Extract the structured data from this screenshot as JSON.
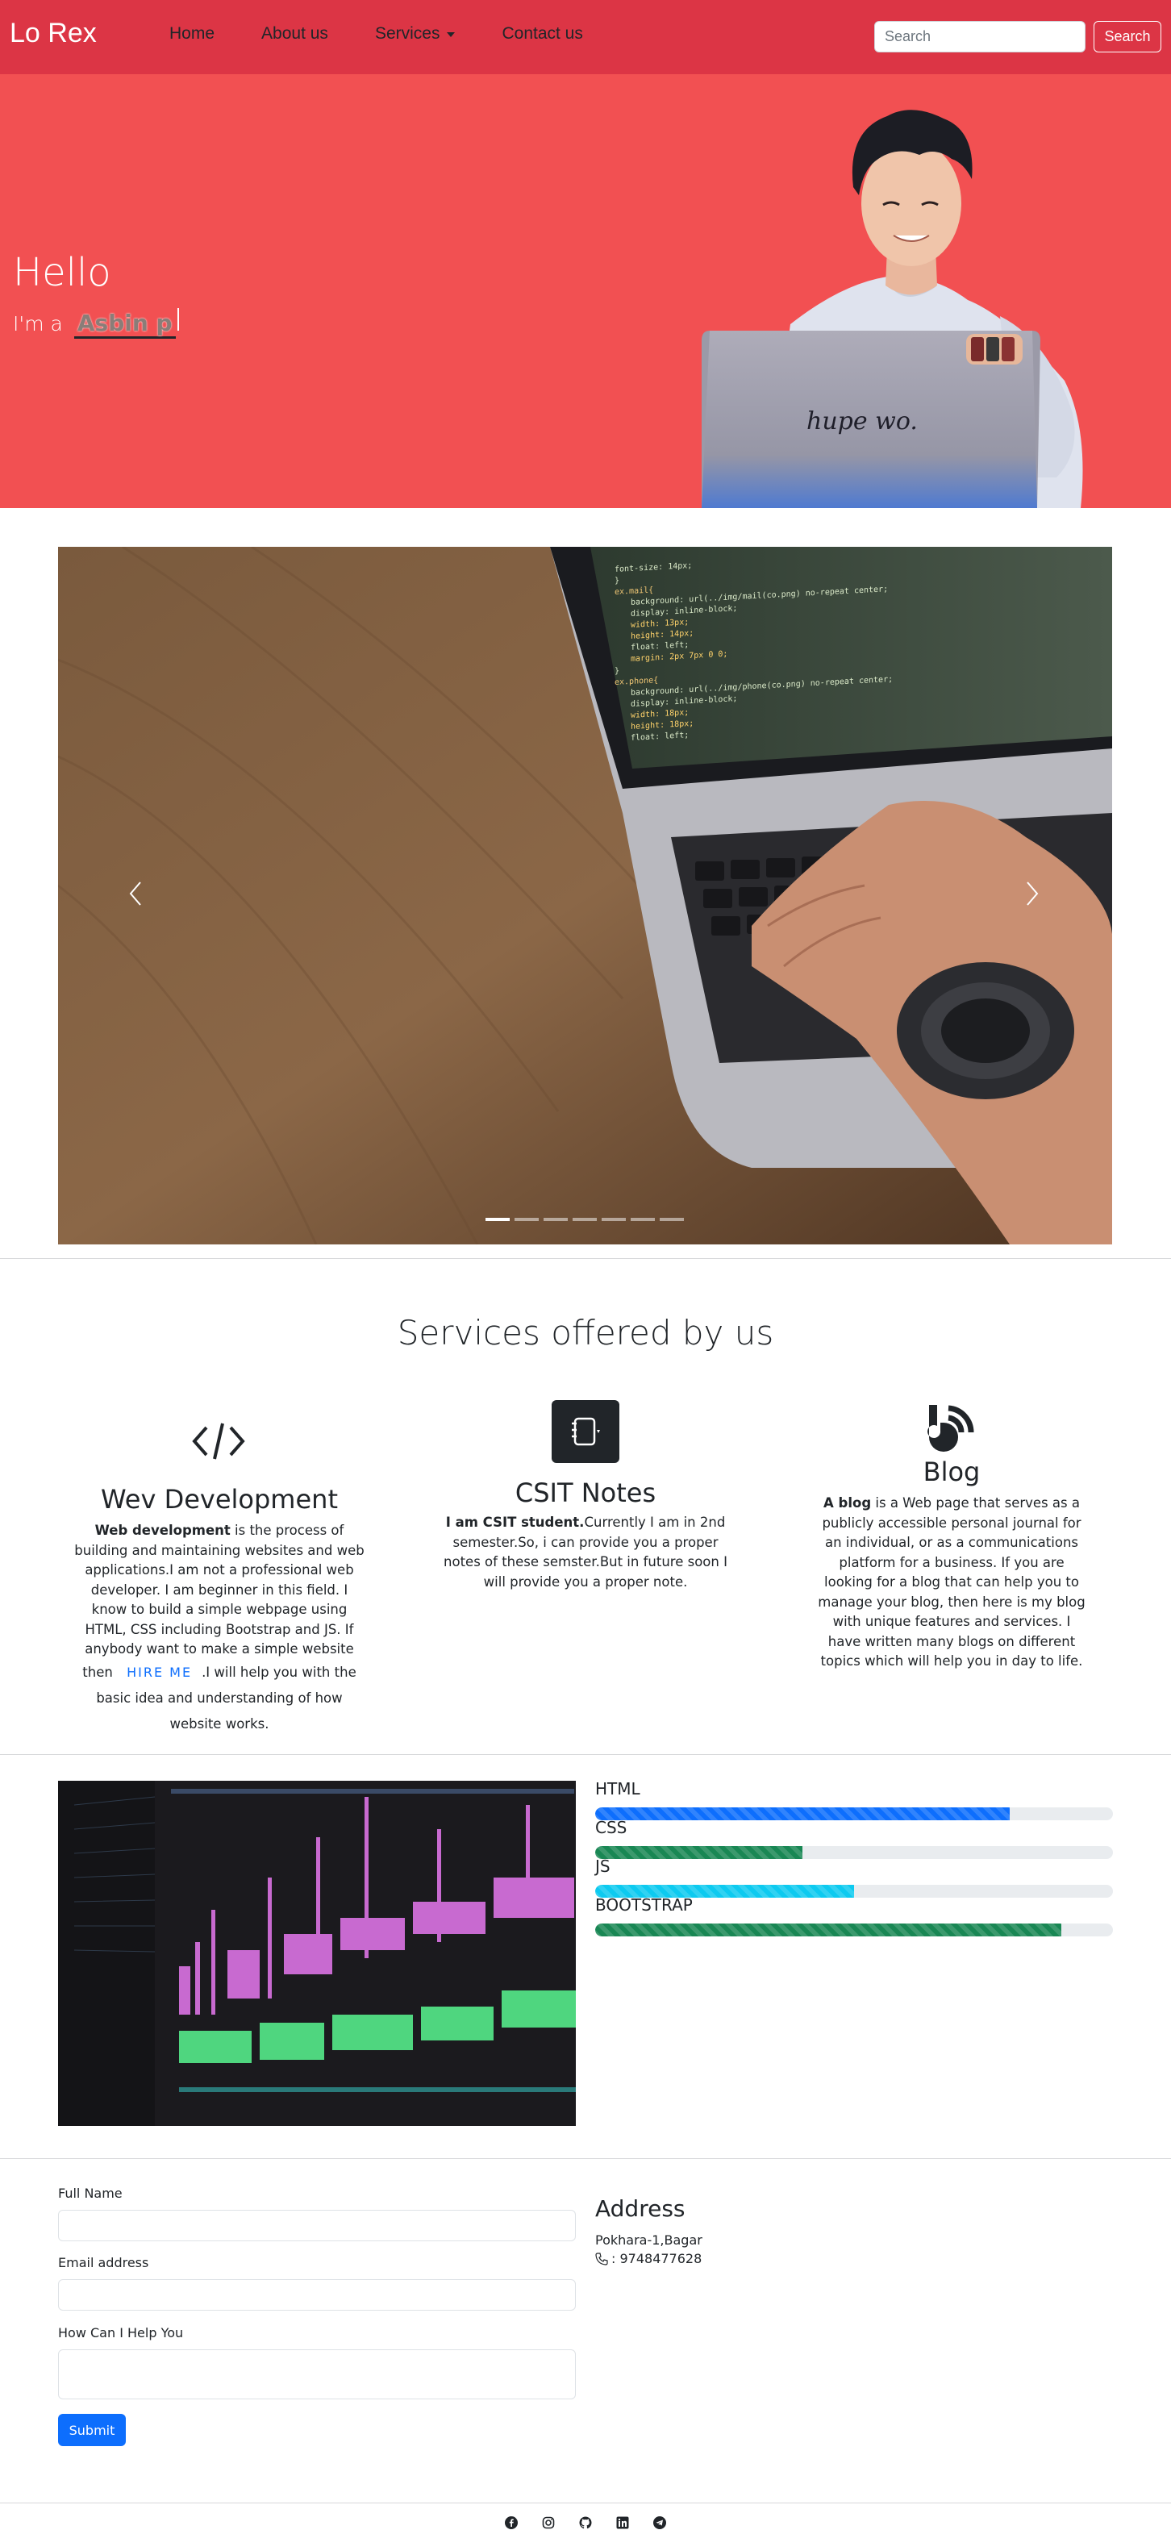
{
  "navbar": {
    "brand": "Lo Rex",
    "links": [
      "Home",
      "About us",
      "Services",
      "Contact us"
    ],
    "search_placeholder": "Search",
    "search_button": "Search",
    "background_color": "#dc3545"
  },
  "hero": {
    "greeting": "Hello",
    "intro": "I'm a",
    "typed_text": "Asbin p",
    "laptop_sticker_text": "hupe wo.",
    "background_color": "#f25052"
  },
  "carousel": {
    "prev_icon": "chevron-left-icon",
    "next_icon": "chevron-right-icon",
    "indicator_count": 7,
    "active_index": 0,
    "code_lines": [
      "font-size: 14px;",
      "}",
      "ex.mail{",
      "background: url(../img/mail(co.png) no-repeat center;",
      "display: inline-block;",
      "width: 13px;",
      "height: 14px;",
      "float: left;",
      "margin: 2px 7px 0 0;",
      "}",
      "ex.phone{",
      "background: url(../img/phone(co.png) no-repeat center;",
      "display: inline-block;",
      "width: 18px;",
      "height: 18px;",
      "float: left;"
    ]
  },
  "services": {
    "title": "Services offered by us",
    "web": {
      "title": "Wev Development",
      "bold": "Web development",
      "text": " is the process of building and maintaining websites and web applications.I am not a professional web developer. I am beginner in this field. I know to build a simple webpage using HTML, CSS including Bootstrap and JS. If anybody want to make a simple website then",
      "hire_link": "HIRE ME",
      "text_after": ".I will help you with the basic idea and understanding of how website works.",
      "icon": "code-icon"
    },
    "csit": {
      "title": "CSIT Notes",
      "bold": "I am CSIT student.",
      "text": "Currently I am in 2nd semester.So, i can provide you a proper notes of these semster.But in future soon I will provide you a proper note.",
      "icon": "notes-icon"
    },
    "blog": {
      "title": "Blog",
      "bold": "A blog",
      "text": " is a Web page that serves as a publicly accessible personal journal for an individual, or as a communications platform for a business. If you are looking for a blog that can help you to manage your blog, then here is my blog with unique features and services. I have written many blogs on different topics which will help you in day to life.",
      "icon": "blog-icon"
    }
  },
  "skills": [
    {
      "name": "HTML",
      "percent": 80,
      "color": "#0d6efd"
    },
    {
      "name": "CSS",
      "percent": 40,
      "color": "#198754"
    },
    {
      "name": "JS",
      "percent": 50,
      "color": "#0dcaf0"
    },
    {
      "name": "BOOTSTRAP",
      "percent": 90,
      "color": "#198754"
    }
  ],
  "contact": {
    "full_name_label": "Full Name",
    "email_label": "Email address",
    "help_label": "How Can I Help You",
    "submit": "Submit",
    "address_title": "Address",
    "address": "Pokhara-1,Bagar",
    "phone": ": 9748477628"
  },
  "footer": {
    "icons": [
      "facebook-icon",
      "instagram-icon",
      "github-icon",
      "linkedin-icon",
      "telegram-icon"
    ]
  }
}
